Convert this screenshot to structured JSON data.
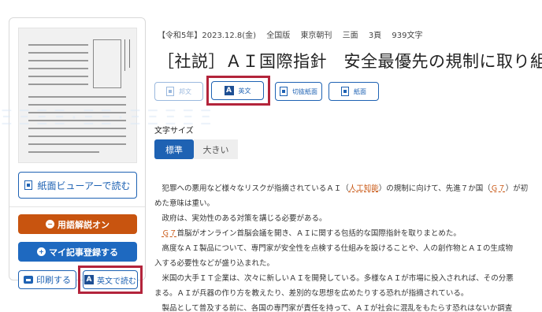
{
  "left_panel": {
    "viewer_button": "紙面ビューアーで読む",
    "terms_button": "用語解説オン",
    "my_article_button": "マイ記事登録する",
    "print_button": "印刷する",
    "english_read_button": "英文で読む",
    "icons": {
      "terms": "minus-circle-icon",
      "my_article": "plus-circle-icon",
      "print": "printer-icon",
      "english": "letter-a-icon"
    }
  },
  "article": {
    "meta": [
      "【令和5年】2023.12.8(金)",
      "全国版",
      "東京朝刊",
      "三面",
      "3頁",
      "939文字"
    ],
    "title": "［社説］ＡＩ国際指針　安全最優先の規制に取り組め"
  },
  "tabs": [
    {
      "label": "邦文",
      "state": "disabled"
    },
    {
      "label": "英文",
      "state": "active"
    },
    {
      "label": "切抜紙面",
      "state": "normal"
    },
    {
      "label": "紙面",
      "state": "normal"
    }
  ],
  "font_size": {
    "label": "文字サイズ",
    "options": [
      "標準",
      "大きい"
    ],
    "selected": "標準"
  },
  "body": {
    "l1a": "　犯罪への悪用など様々なリスクが指摘されているＡＩ（",
    "l1u": "人工知能",
    "l1b": "）の規制に向けて、先進７か国（",
    "l1u2": "Ｇ７",
    "l1c": "）が初",
    "l2": "めた意味は重い。",
    "l3": "　政府は、実効性のある対策を講じる必要がある。",
    "l4u": "Ｇ７",
    "l4": "首脳がオンライン首脳会議を開き、ＡＩに関する包括的な国際指針を取りまとめた。",
    "l5": "　高度なＡＩ製品について、専門家が安全性を点検する仕組みを設けることや、人の創作物とＡＩの生成物",
    "l6": "入する必要性などが盛り込まれた。",
    "l7": "　米国の大手ＩＴ企業は、次々に新しいＡＩを開発している。多様なＡＩが市場に投入されれば、その分悪",
    "l8": "まる。ＡＩが兵器の作り方を教えたり、差別的な思想を広めたりする恐れが指摘されている。",
    "l9": "　製品として普及する前に、各国の専門家が責任を持って、ＡＩが社会に混乱をもたらす恐れはないか調査"
  },
  "colors": {
    "accent_blue": "#1e62b3",
    "orange": "#c8540f",
    "highlight_red": "#b3243b"
  }
}
